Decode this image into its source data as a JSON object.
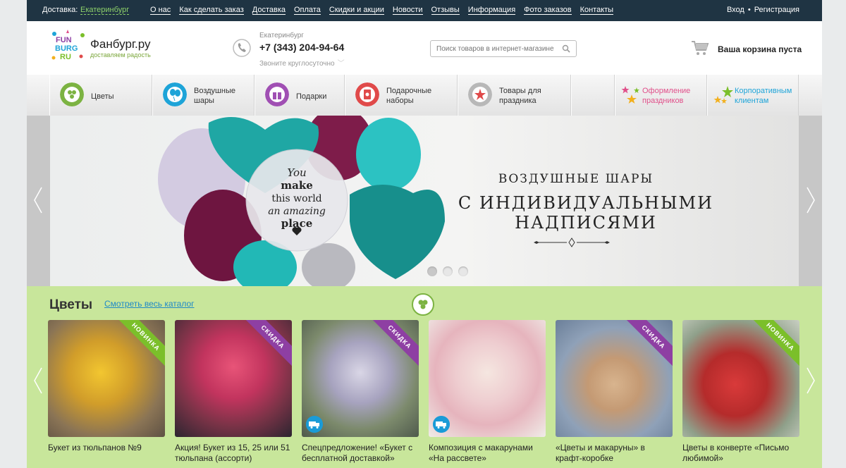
{
  "topbar": {
    "city_label": "Доставка:",
    "city": "Екатеринбург",
    "nav": [
      "О нас",
      "Как сделать заказ",
      "Доставка",
      "Оплата",
      "Скидки и акции",
      "Новости",
      "Отзывы",
      "Информация",
      "Фото заказов",
      "Контакты"
    ],
    "login": "Вход",
    "separator": "•",
    "register": "Регистрация"
  },
  "header": {
    "logo_text": [
      "FUN",
      "BURG",
      "RU"
    ],
    "site_name": "Фанбург.ру",
    "slogan": "доставляем радость",
    "city": "Екатеринбург",
    "phone": "+7 (343) 204-94-64",
    "call_note": "Звоните круглосуточно",
    "search_placeholder": "Поиск товаров в интернет-магазине",
    "cart": "Ваша корзина пуста"
  },
  "categories": [
    {
      "label": "Цветы",
      "icon": "flower-icon",
      "color": "#7cb342"
    },
    {
      "label": "Воздушные шары",
      "icon": "balloon-icon",
      "color": "#1ea4d8"
    },
    {
      "label": "Подарки",
      "icon": "gift-icon",
      "color": "#a04fb3"
    },
    {
      "label": "Подарочные наборы",
      "icon": "gift-set-icon",
      "color": "#e04a4a"
    },
    {
      "label": "Товары для праздника",
      "icon": "party-icon",
      "color": "#b0b0b0"
    }
  ],
  "special_categories": [
    {
      "label": "Оформление праздников",
      "color": "#e0508a"
    },
    {
      "label": "Корпоративным клиентам",
      "color": "#1ea4d8"
    }
  ],
  "banner": {
    "line1": "ВОЗДУШНЫЕ ШАРЫ",
    "line2": "С ИНДИВИДУАЛЬНЫМИ",
    "line3": "НАДПИСЯМИ",
    "balloon_text": "You make this world an amazing place",
    "slide_count": 3,
    "active_slide": 1
  },
  "flowers": {
    "title": "Цветы",
    "see_all": "Смотреть весь каталог",
    "products": [
      {
        "name": "Букет из тюльпанов №9",
        "ribbon": "НОВИНКА",
        "ribbon_color": "#7bbf2a",
        "bg": "#c7a23a",
        "delivery": false
      },
      {
        "name": "Акция! Букет из 15, 25 или 51 тюльпана (ассорти)",
        "ribbon": "СКИДКА",
        "ribbon_color": "#8e3fa3",
        "bg": "#c24a74",
        "delivery": false
      },
      {
        "name": "Спецпредложение! «Букет с бесплатной доставкой»",
        "ribbon": "СКИДКА",
        "ribbon_color": "#8e3fa3",
        "bg": "#a8a4b8",
        "delivery": true
      },
      {
        "name": "Композиция с макарунами «На рассвете»",
        "ribbon": "",
        "ribbon_color": "",
        "bg": "#e8ccc8",
        "delivery": true
      },
      {
        "name": "«Цветы и макаруны» в крафт-коробке",
        "ribbon": "СКИДКА",
        "ribbon_color": "#8e3fa3",
        "bg": "#c6b7a8",
        "delivery": false
      },
      {
        "name": "Цветы в конверте «Письмо любимой»",
        "ribbon": "НОВИНКА",
        "ribbon_color": "#7bbf2a",
        "bg": "#c33a3a",
        "delivery": false
      }
    ]
  }
}
